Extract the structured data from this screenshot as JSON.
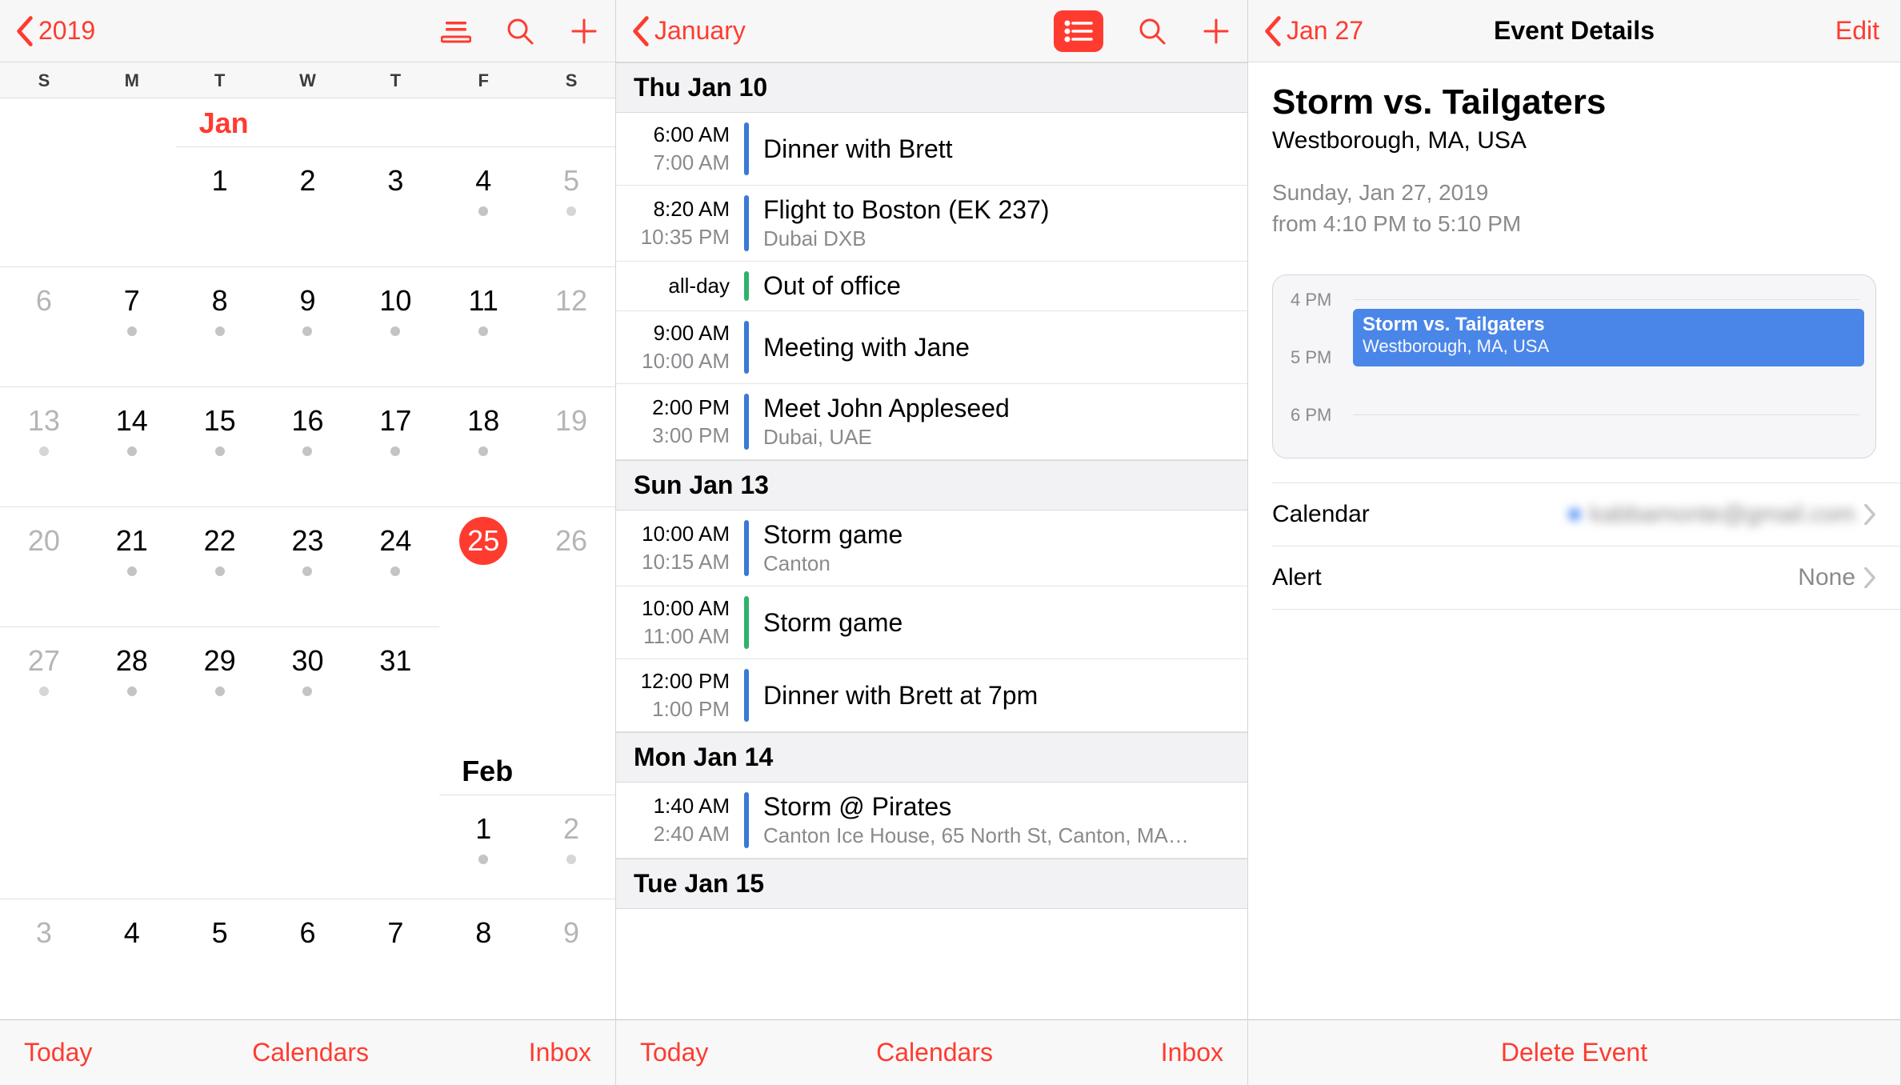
{
  "accent": "#ff3b30",
  "pane1": {
    "back_label": "2019",
    "dow": [
      "S",
      "M",
      "T",
      "W",
      "T",
      "F",
      "S"
    ],
    "months": [
      {
        "label": "Jan",
        "is_current": true,
        "label_col": 2,
        "first_weekday": 2,
        "days": [
          {
            "n": 1,
            "dot": false
          },
          {
            "n": 2,
            "dot": false
          },
          {
            "n": 3,
            "dot": false
          },
          {
            "n": 4,
            "dot": true
          },
          {
            "n": 5,
            "dot": true,
            "prev": true
          },
          {
            "n": 6,
            "dot": false,
            "prev": true
          },
          {
            "n": 7,
            "dot": true
          },
          {
            "n": 8,
            "dot": true
          },
          {
            "n": 9,
            "dot": true
          },
          {
            "n": 10,
            "dot": true
          },
          {
            "n": 11,
            "dot": true
          },
          {
            "n": 12,
            "dot": false,
            "prev": true
          },
          {
            "n": 13,
            "dot": true,
            "prev": true
          },
          {
            "n": 14,
            "dot": true
          },
          {
            "n": 15,
            "dot": true
          },
          {
            "n": 16,
            "dot": true
          },
          {
            "n": 17,
            "dot": true
          },
          {
            "n": 18,
            "dot": true
          },
          {
            "n": 19,
            "dot": false,
            "prev": true
          },
          {
            "n": 20,
            "dot": false,
            "prev": true
          },
          {
            "n": 21,
            "dot": true
          },
          {
            "n": 22,
            "dot": true
          },
          {
            "n": 23,
            "dot": true
          },
          {
            "n": 24,
            "dot": true
          },
          {
            "n": 25,
            "dot": false,
            "today": true
          },
          {
            "n": 26,
            "dot": false,
            "prev": true
          },
          {
            "n": 27,
            "dot": true,
            "prev": true
          },
          {
            "n": 28,
            "dot": true
          },
          {
            "n": 29,
            "dot": true
          },
          {
            "n": 30,
            "dot": true
          },
          {
            "n": 31,
            "dot": false
          }
        ]
      },
      {
        "label": "Feb",
        "is_current": false,
        "label_col": 5,
        "first_weekday": 5,
        "days": [
          {
            "n": 1,
            "dot": true
          },
          {
            "n": 2,
            "dot": true,
            "prev": true
          },
          {
            "n": 3,
            "dot": false,
            "prev": true
          },
          {
            "n": 4,
            "dot": false
          },
          {
            "n": 5,
            "dot": false
          },
          {
            "n": 6,
            "dot": false
          },
          {
            "n": 7,
            "dot": false
          },
          {
            "n": 8,
            "dot": false
          },
          {
            "n": 9,
            "dot": false,
            "prev": true
          }
        ]
      }
    ],
    "tabbar": {
      "today": "Today",
      "calendars": "Calendars",
      "inbox": "Inbox"
    }
  },
  "pane2": {
    "back_label": "January",
    "sections": [
      {
        "header": "Thu  Jan 10",
        "events": [
          {
            "t1": "6:00 AM",
            "t2": "7:00 AM",
            "title": "Dinner with Brett",
            "sub": "",
            "bar": "blue"
          },
          {
            "t1": "8:20 AM",
            "t2": "10:35 PM",
            "title": "Flight to Boston (EK 237)",
            "sub": "Dubai DXB",
            "bar": "blue"
          },
          {
            "allday": "all-day",
            "title": "Out of office",
            "sub": "",
            "bar": "green"
          },
          {
            "t1": "9:00 AM",
            "t2": "10:00 AM",
            "title": "Meeting with Jane",
            "sub": "",
            "bar": "blue"
          },
          {
            "t1": "2:00 PM",
            "t2": "3:00 PM",
            "title": "Meet John Appleseed",
            "sub": "Dubai, UAE",
            "bar": "blue"
          }
        ]
      },
      {
        "header": "Sun  Jan 13",
        "events": [
          {
            "t1": "10:00 AM",
            "t2": "10:15 AM",
            "title": "Storm game",
            "sub": "Canton",
            "bar": "blue"
          },
          {
            "t1": "10:00 AM",
            "t2": "11:00 AM",
            "title": "Storm game",
            "sub": "",
            "bar": "green"
          },
          {
            "t1": "12:00 PM",
            "t2": "1:00 PM",
            "title": "Dinner with Brett at 7pm",
            "sub": "",
            "bar": "blue"
          }
        ]
      },
      {
        "header": "Mon  Jan 14",
        "events": [
          {
            "t1": "1:40 AM",
            "t2": "2:40 AM",
            "title": "Storm @ Pirates",
            "sub": "Canton Ice House, 65 North St, Canton, MA…",
            "bar": "blue"
          }
        ]
      },
      {
        "header": "Tue  Jan 15",
        "events": []
      }
    ],
    "tabbar": {
      "today": "Today",
      "calendars": "Calendars",
      "inbox": "Inbox"
    }
  },
  "pane3": {
    "back_label": "Jan 27",
    "nav_title": "Event Details",
    "edit_label": "Edit",
    "event": {
      "title": "Storm vs. Tailgaters",
      "location": "Westborough, MA, USA",
      "date": "Sunday, Jan 27, 2019",
      "time": "from 4:10 PM to 5:10 PM"
    },
    "timeline": {
      "labels": [
        "4 PM",
        "5 PM",
        "6 PM"
      ],
      "block_title": "Storm vs. Tailgaters",
      "block_sub": "Westborough, MA, USA"
    },
    "settings": [
      {
        "label": "Calendar",
        "value": "kabbamonte@gmail.com",
        "dot": true,
        "blur": true
      },
      {
        "label": "Alert",
        "value": "None",
        "dot": false,
        "blur": false
      }
    ],
    "delete_label": "Delete Event"
  }
}
